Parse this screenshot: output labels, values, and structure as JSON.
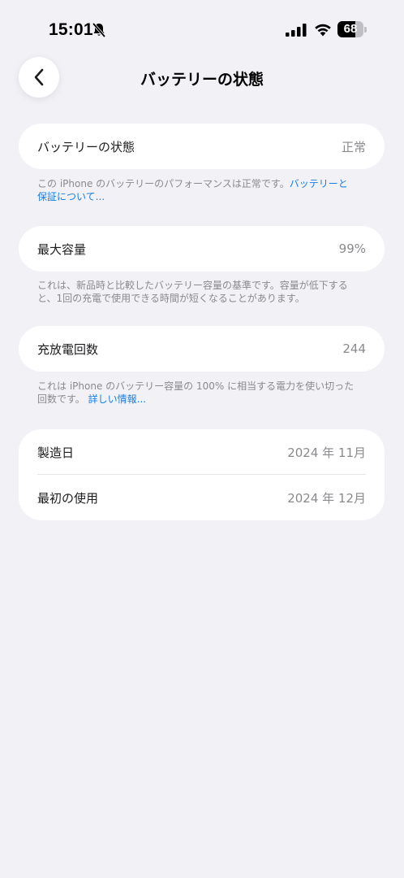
{
  "status_bar": {
    "time": "15:01",
    "battery_level": 68,
    "battery_text": "68",
    "icons": [
      "mute-icon",
      "signal-icon",
      "wifi-icon",
      "battery-icon"
    ]
  },
  "nav": {
    "back_icon": "chevron-left-icon",
    "title": "バッテリーの状態"
  },
  "health": {
    "label": "バッテリーの状態",
    "value": "正常",
    "footnote_text": "この iPhone のバッテリーのパフォーマンスは正常です。",
    "footnote_link_1": "バッテリーと",
    "footnote_link_2": "保証について..."
  },
  "capacity": {
    "label": "最大容量",
    "value": "99%",
    "footnote_line_1": "これは、新品時と比較したバッテリー容量の基準です。容量が低下する",
    "footnote_line_2": "と、1回の充電で使用できる時間が短くなることがあります。"
  },
  "cycles": {
    "label": "充放電回数",
    "value": "244",
    "footnote_line_1": "これは iPhone のバッテリー容量の 100% に相当する電力を使い切った",
    "footnote_line_2_text": "回数です。",
    "footnote_link": "詳しい情報..."
  },
  "dates": {
    "manufacture_label": "製造日",
    "manufacture_value": "2024 年 11月",
    "first_use_label": "最初の使用",
    "first_use_value": "2024 年 12月"
  },
  "colors": {
    "background": "#f1f1f6",
    "card": "#ffffff",
    "link": "#1a7fe0",
    "secondary_text": "#8a8a8e"
  }
}
